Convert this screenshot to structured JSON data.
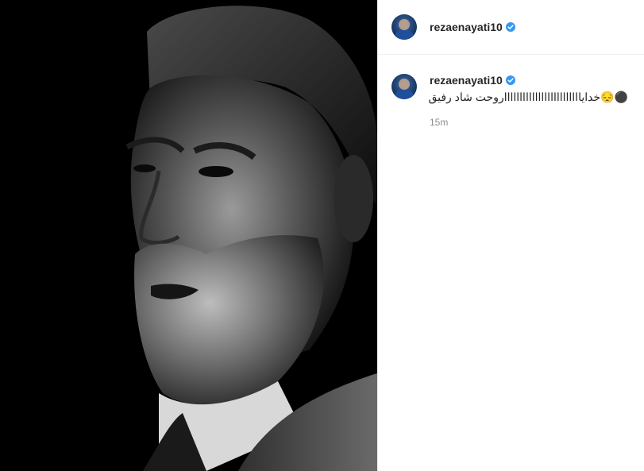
{
  "post": {
    "username": "rezaenayati10",
    "comment": {
      "username": "rezaenayati10",
      "text": "⚫😔خدایاااااااااااااااااااااااااروحت شاد رفیق",
      "time": "15m"
    }
  },
  "colors": {
    "verified": "#3897f0",
    "muted_text": "#8e8e8e",
    "photo_bg": "#000000"
  },
  "icons": {
    "verified": "verified-badge-icon"
  }
}
